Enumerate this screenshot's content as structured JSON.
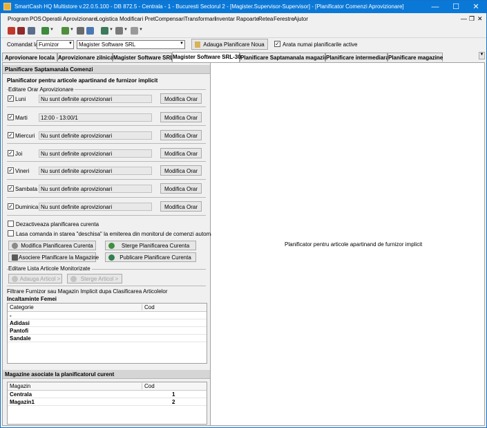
{
  "window": {
    "title": "SmartCash HQ Multistore v.22.0.5.100 - DB 872.5 - Centrala - 1 - Bucuresti Sectorul 2 - [Magister.Supervisor-Supervisor] - [Planificator Comenzi Aprovizionare]",
    "minimize": "—",
    "maximize": "☐",
    "close": "✕"
  },
  "menu": {
    "items": [
      "Program",
      "POS",
      "Operatii",
      "Aprovizionare",
      "Logistica",
      "Modificari Pret",
      "Compensari",
      "Transformari",
      "Inventar",
      "Rapoarte",
      "Retea",
      "Ferestre",
      "Ajutor"
    ],
    "mdi_min": "—",
    "mdi_restore": "❐",
    "mdi_close": "✕"
  },
  "toolbar": {
    "icons": [
      "print-icon",
      "car-icon",
      "printer-icon",
      "export-icon",
      "user-icon",
      "document-icon",
      "calendar-icon",
      "network-icon",
      "report-icon",
      "gear-icon",
      "window-icon"
    ]
  },
  "command": {
    "label": "Comandat la",
    "type_value": "Furnizor",
    "supplier_value": "Magister Software SRL",
    "add_button": "Adauga Planificare Noua",
    "active_only_label": "Arata numai planificarile active",
    "active_only_checked": "✓"
  },
  "tabs": [
    "Aprovionare locala",
    "Aprovizionare zilnica",
    "Magister Software SRL",
    "Magister Software SRL-30",
    "Planificare Saptamanala magazine",
    "Planificare intermediara",
    "Planificare magazine"
  ],
  "tabs_scroll": "▼",
  "planner": {
    "header": "Planificare Saptamanala Comenzi",
    "subtitle": "Planificator pentru articole apartinand de furnizor implicit",
    "schedule_group": "Editare Orar Aprovizionare",
    "check_mark": "✓",
    "days": [
      {
        "name": "Luni",
        "value": "Nu sunt definite aprovizionari",
        "button": "Modifica Orar"
      },
      {
        "name": "Marti",
        "value": "12:00 - 13:00/1",
        "button": "Modifica Orar"
      },
      {
        "name": "Miercuri",
        "value": "Nu sunt definite aprovizionari",
        "button": "Modifica Orar"
      },
      {
        "name": "Joi",
        "value": "Nu sunt definite aprovizionari",
        "button": "Modifica Orar"
      },
      {
        "name": "Vineri",
        "value": "Nu sunt definite aprovizionari",
        "button": "Modifica Orar"
      },
      {
        "name": "Sambata",
        "value": "Nu sunt definite aprovizionari",
        "button": "Modifica Orar"
      },
      {
        "name": "Duminica",
        "value": "Nu sunt definite aprovizionari",
        "button": "Modifica Orar"
      }
    ],
    "deactivate_label": "Dezactiveaza planificarea curenta",
    "leave_open_label": "Lasa comanda in starea \"deschisa\" la emiterea din monitorul de comenzi automate",
    "modify_button": "Modifica Planificarea Curenta",
    "delete_button": "Sterge Planificarea Curenta",
    "associate_button": "Asociere Planificare la Magazine",
    "publish_button": "Publicare Planificare Curenta",
    "articles_group": "Editare Lista Articole Monitorizate",
    "add_article_button": "Adauga Articol >",
    "delete_article_button": "Sterge Articol >",
    "filter_label": "Filtrare Furnizor sau Magazin Implicit dupa Clasificarea Articolelor",
    "category_group": "Incaltaminte Femei",
    "category_grid": {
      "columns": [
        "Categorie",
        "Cod"
      ],
      "rows": [
        {
          "categorie": "-",
          "cod": ""
        },
        {
          "categorie": "Adidasi",
          "cod": ""
        },
        {
          "categorie": "Pantofi",
          "cod": ""
        },
        {
          "categorie": "Sandale",
          "cod": ""
        }
      ]
    },
    "stores_header": "Magazine asociate la planificatorul curent",
    "stores_grid": {
      "columns": [
        "Magazin",
        "Cod"
      ],
      "rows": [
        {
          "magazin": "Centrala",
          "cod": "1"
        },
        {
          "magazin": "Magazin1",
          "cod": "2"
        }
      ]
    }
  },
  "right_panel": {
    "text": "Planificator pentru articole apartinand de furnizor implicit"
  }
}
